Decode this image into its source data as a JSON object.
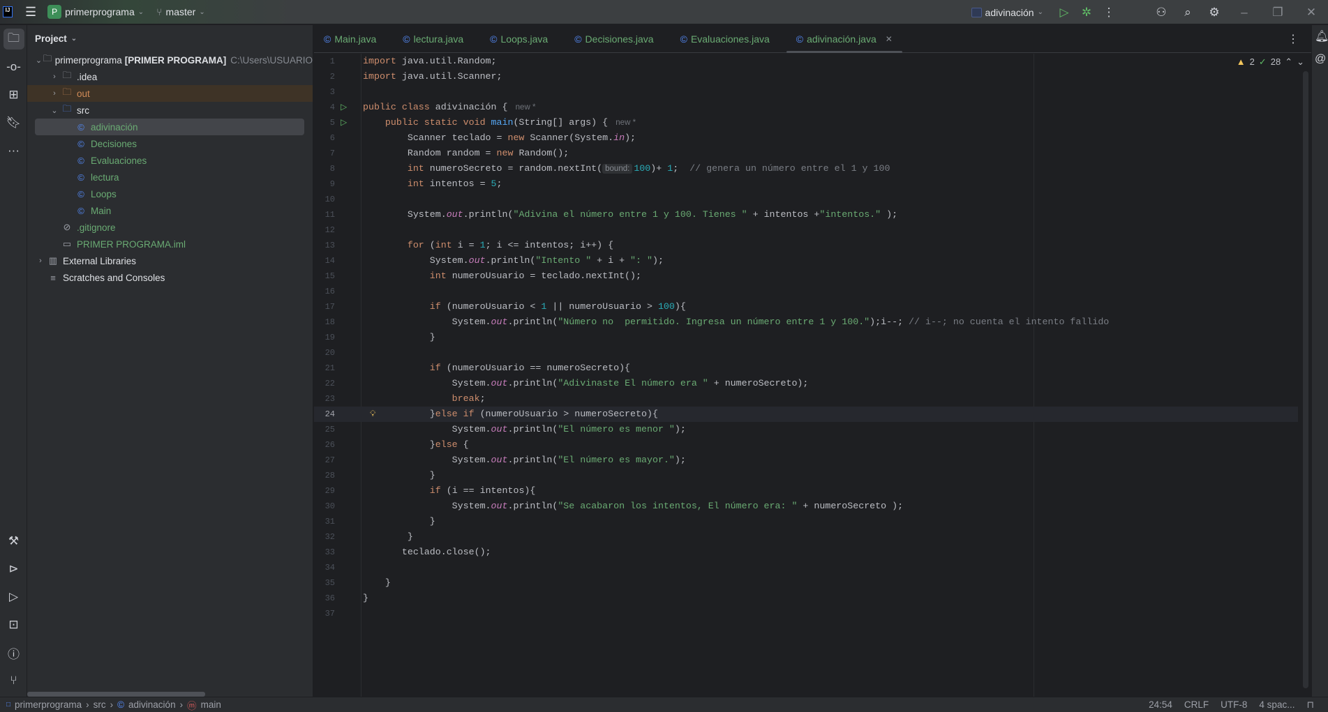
{
  "titlebar": {
    "project_badge": "P",
    "project": "primerprograma",
    "branch": "master",
    "run_config": "adivinación"
  },
  "project_panel": {
    "title": "Project",
    "items": [
      {
        "label": "primerprograma",
        "bold": "[PRIMER PROGRAMA]",
        "path": "C:\\Users\\USUARIO",
        "depth": 0,
        "arrow": "open",
        "icon": "project"
      },
      {
        "label": ".idea",
        "depth": 1,
        "arrow": "closed",
        "icon": "folder"
      },
      {
        "label": "out",
        "depth": 1,
        "arrow": "closed",
        "icon": "folder-excluded"
      },
      {
        "label": "src",
        "depth": 1,
        "arrow": "open",
        "icon": "folder-source"
      },
      {
        "label": "adivinación",
        "depth": 2,
        "icon": "java-class",
        "selected": true
      },
      {
        "label": "Decisiones",
        "depth": 2,
        "icon": "java-class"
      },
      {
        "label": "Evaluaciones",
        "depth": 2,
        "icon": "java-class"
      },
      {
        "label": "lectura",
        "depth": 2,
        "icon": "java-class"
      },
      {
        "label": "Loops",
        "depth": 2,
        "icon": "java-class"
      },
      {
        "label": "Main",
        "depth": 2,
        "icon": "java-class"
      },
      {
        "label": ".gitignore",
        "depth": 1,
        "icon": "ignored-file"
      },
      {
        "label": "PRIMER PROGRAMA.iml",
        "depth": 1,
        "icon": "module-file"
      },
      {
        "label": "External Libraries",
        "depth": 0,
        "arrow": "closed",
        "icon": "libraries"
      },
      {
        "label": "Scratches and Consoles",
        "depth": 0,
        "icon": "scratches"
      }
    ]
  },
  "tabs": [
    {
      "label": "Main.java"
    },
    {
      "label": "lectura.java"
    },
    {
      "label": "Loops.java"
    },
    {
      "label": "Decisiones.java"
    },
    {
      "label": "Evaluaciones.java"
    },
    {
      "label": "adivinación.java",
      "active": true
    }
  ],
  "inspections": {
    "warnings": "2",
    "weak_warnings": "28"
  },
  "editor": {
    "current_line": 24,
    "lines": [
      [
        [
          "k",
          "import "
        ],
        [
          "p",
          "java.util.Random;"
        ]
      ],
      [
        [
          "k",
          "import "
        ],
        [
          "p",
          "java.util.Scanner;"
        ]
      ],
      [],
      [
        [
          "k",
          "public class "
        ],
        [
          "p",
          "adivinación { "
        ],
        [
          "g",
          " new *"
        ]
      ],
      [
        [
          "p",
          "    "
        ],
        [
          "k",
          "public static void "
        ],
        [
          "m",
          "main"
        ],
        [
          "p",
          "(String[] args) { "
        ],
        [
          "g",
          " new *"
        ]
      ],
      [
        [
          "p",
          "        Scanner teclado = "
        ],
        [
          "k",
          "new "
        ],
        [
          "p",
          "Scanner(System."
        ],
        [
          "f",
          "in"
        ],
        [
          "p",
          ");"
        ]
      ],
      [
        [
          "p",
          "        Random random = "
        ],
        [
          "k",
          "new "
        ],
        [
          "p",
          "Random();"
        ]
      ],
      [
        [
          "p",
          "        "
        ],
        [
          "k",
          "int "
        ],
        [
          "p",
          "numeroSecreto = random.nextInt("
        ],
        [
          "h",
          "bound:"
        ],
        [
          "n",
          "100"
        ],
        [
          "p",
          ")+ "
        ],
        [
          "n",
          "1"
        ],
        [
          "p",
          ";  "
        ],
        [
          "c",
          "// genera un número entre el 1 y 100"
        ]
      ],
      [
        [
          "p",
          "        "
        ],
        [
          "k",
          "int "
        ],
        [
          "p",
          "intentos = "
        ],
        [
          "n",
          "5"
        ],
        [
          "p",
          ";"
        ]
      ],
      [],
      [
        [
          "p",
          "        System."
        ],
        [
          "f",
          "out"
        ],
        [
          "p",
          ".println("
        ],
        [
          "s",
          "\"Adivina el número entre 1 y 100. Tienes \""
        ],
        [
          "p",
          " + intentos +"
        ],
        [
          "s",
          "\"intentos.\""
        ],
        [
          "p",
          " );"
        ]
      ],
      [],
      [
        [
          "p",
          "        "
        ],
        [
          "k",
          "for "
        ],
        [
          "p",
          "("
        ],
        [
          "k",
          "int "
        ],
        [
          "p",
          "i = "
        ],
        [
          "n",
          "1"
        ],
        [
          "p",
          "; i <= intentos; i++) {"
        ]
      ],
      [
        [
          "p",
          "            System."
        ],
        [
          "f",
          "out"
        ],
        [
          "p",
          ".println("
        ],
        [
          "s",
          "\"Intento \""
        ],
        [
          "p",
          " + i + "
        ],
        [
          "s",
          "\": \""
        ],
        [
          "p",
          ");"
        ]
      ],
      [
        [
          "p",
          "            "
        ],
        [
          "k",
          "int "
        ],
        [
          "p",
          "numeroUsuario = teclado.nextInt();"
        ]
      ],
      [],
      [
        [
          "p",
          "            "
        ],
        [
          "k",
          "if "
        ],
        [
          "p",
          "(numeroUsuario < "
        ],
        [
          "n",
          "1"
        ],
        [
          "p",
          " || numeroUsuario > "
        ],
        [
          "n",
          "100"
        ],
        [
          "p",
          "){"
        ]
      ],
      [
        [
          "p",
          "                System."
        ],
        [
          "f",
          "out"
        ],
        [
          "p",
          ".println("
        ],
        [
          "s",
          "\"Número no  permitido. Ingresa un número entre 1 y 100.\""
        ],
        [
          "p",
          ");i--; "
        ],
        [
          "c",
          "// i--; no cuenta el intento fallido"
        ]
      ],
      [
        [
          "p",
          "            }"
        ]
      ],
      [],
      [
        [
          "p",
          "            "
        ],
        [
          "k",
          "if "
        ],
        [
          "p",
          "(numeroUsuario == numeroSecreto){"
        ]
      ],
      [
        [
          "p",
          "                System."
        ],
        [
          "f",
          "out"
        ],
        [
          "p",
          ".println("
        ],
        [
          "s",
          "\"Adivinaste El número era \""
        ],
        [
          "p",
          " + numeroSecreto);"
        ]
      ],
      [
        [
          "p",
          "                "
        ],
        [
          "k",
          "break"
        ],
        [
          "p",
          ";"
        ]
      ],
      [
        [
          "p",
          "            }"
        ],
        [
          "k",
          "else if "
        ],
        [
          "p",
          "(numeroUsuario > numeroSecreto){"
        ]
      ],
      [
        [
          "p",
          "                System."
        ],
        [
          "f",
          "out"
        ],
        [
          "p",
          ".println("
        ],
        [
          "s",
          "\"El número es menor \""
        ],
        [
          "p",
          ");"
        ]
      ],
      [
        [
          "p",
          "            }"
        ],
        [
          "k",
          "else "
        ],
        [
          "p",
          "{"
        ]
      ],
      [
        [
          "p",
          "                System."
        ],
        [
          "f",
          "out"
        ],
        [
          "p",
          ".println("
        ],
        [
          "s",
          "\"El número es mayor.\""
        ],
        [
          "p",
          ");"
        ]
      ],
      [
        [
          "p",
          "            }"
        ]
      ],
      [
        [
          "p",
          "            "
        ],
        [
          "k",
          "if "
        ],
        [
          "p",
          "(i == intentos){"
        ]
      ],
      [
        [
          "p",
          "                System."
        ],
        [
          "f",
          "out"
        ],
        [
          "p",
          ".println("
        ],
        [
          "s",
          "\"Se acabaron los intentos, El número era: \""
        ],
        [
          "p",
          " + numeroSecreto );"
        ]
      ],
      [
        [
          "p",
          "            }"
        ]
      ],
      [
        [
          "p",
          "        }"
        ]
      ],
      [
        [
          "p",
          "       teclado.close();"
        ]
      ],
      [],
      [
        [
          "p",
          "    }"
        ]
      ],
      [
        [
          "p",
          "}"
        ]
      ],
      []
    ],
    "run_gutter_lines": [
      4,
      5
    ],
    "bulb_line": 24
  },
  "statusbar": {
    "breadcrumb": [
      "primerprograma",
      "src",
      "adivinación",
      "main"
    ],
    "position": "24:54",
    "line_ending": "CRLF",
    "encoding": "UTF-8",
    "indent": "4 spac..."
  }
}
